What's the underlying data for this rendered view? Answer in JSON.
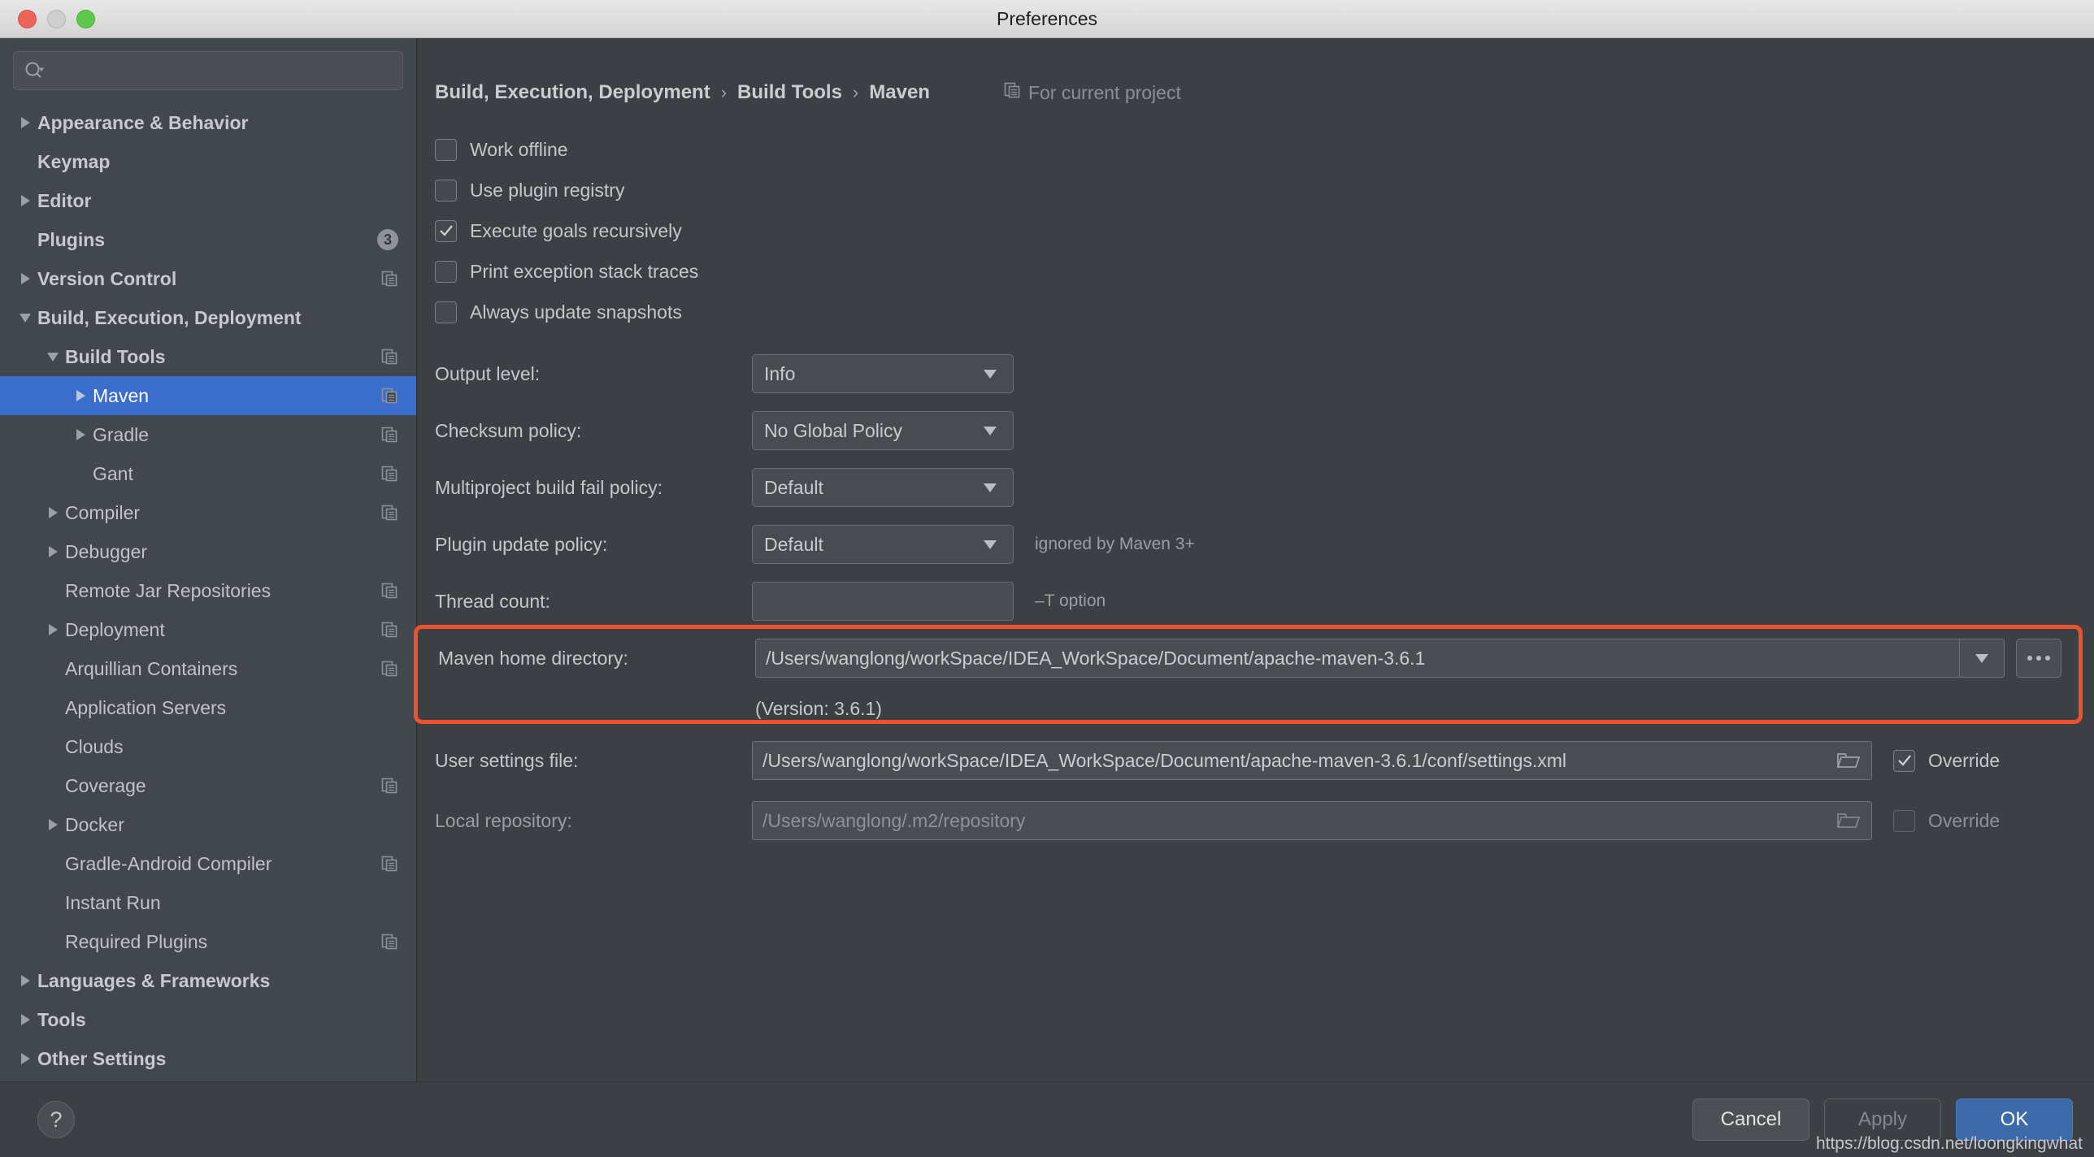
{
  "window": {
    "title": "Preferences"
  },
  "search": {
    "value": "",
    "placeholder": "",
    "icon": "search-icon"
  },
  "sidebar": {
    "items": [
      {
        "label": "Appearance & Behavior",
        "indent": 0,
        "arrow": "right",
        "bold": true,
        "scope": false,
        "badge": null,
        "selected": false
      },
      {
        "label": "Keymap",
        "indent": 0,
        "arrow": "none",
        "bold": true,
        "scope": false,
        "badge": null,
        "selected": false
      },
      {
        "label": "Editor",
        "indent": 0,
        "arrow": "right",
        "bold": true,
        "scope": false,
        "badge": null,
        "selected": false
      },
      {
        "label": "Plugins",
        "indent": 0,
        "arrow": "none",
        "bold": true,
        "scope": false,
        "badge": "3",
        "selected": false
      },
      {
        "label": "Version Control",
        "indent": 0,
        "arrow": "right",
        "bold": true,
        "scope": true,
        "badge": null,
        "selected": false
      },
      {
        "label": "Build, Execution, Deployment",
        "indent": 0,
        "arrow": "down",
        "bold": true,
        "scope": false,
        "badge": null,
        "selected": false
      },
      {
        "label": "Build Tools",
        "indent": 1,
        "arrow": "down",
        "bold": true,
        "scope": true,
        "badge": null,
        "selected": false
      },
      {
        "label": "Maven",
        "indent": 2,
        "arrow": "right",
        "bold": false,
        "scope": true,
        "badge": null,
        "selected": true
      },
      {
        "label": "Gradle",
        "indent": 2,
        "arrow": "right",
        "bold": false,
        "scope": true,
        "badge": null,
        "selected": false
      },
      {
        "label": "Gant",
        "indent": 2,
        "arrow": "none",
        "bold": false,
        "scope": true,
        "badge": null,
        "selected": false
      },
      {
        "label": "Compiler",
        "indent": 1,
        "arrow": "right",
        "bold": false,
        "scope": true,
        "badge": null,
        "selected": false
      },
      {
        "label": "Debugger",
        "indent": 1,
        "arrow": "right",
        "bold": false,
        "scope": false,
        "badge": null,
        "selected": false
      },
      {
        "label": "Remote Jar Repositories",
        "indent": 1,
        "arrow": "none",
        "bold": false,
        "scope": true,
        "badge": null,
        "selected": false
      },
      {
        "label": "Deployment",
        "indent": 1,
        "arrow": "right",
        "bold": false,
        "scope": true,
        "badge": null,
        "selected": false
      },
      {
        "label": "Arquillian Containers",
        "indent": 1,
        "arrow": "none",
        "bold": false,
        "scope": true,
        "badge": null,
        "selected": false
      },
      {
        "label": "Application Servers",
        "indent": 1,
        "arrow": "none",
        "bold": false,
        "scope": false,
        "badge": null,
        "selected": false
      },
      {
        "label": "Clouds",
        "indent": 1,
        "arrow": "none",
        "bold": false,
        "scope": false,
        "badge": null,
        "selected": false
      },
      {
        "label": "Coverage",
        "indent": 1,
        "arrow": "none",
        "bold": false,
        "scope": true,
        "badge": null,
        "selected": false
      },
      {
        "label": "Docker",
        "indent": 1,
        "arrow": "right",
        "bold": false,
        "scope": false,
        "badge": null,
        "selected": false
      },
      {
        "label": "Gradle-Android Compiler",
        "indent": 1,
        "arrow": "none",
        "bold": false,
        "scope": true,
        "badge": null,
        "selected": false
      },
      {
        "label": "Instant Run",
        "indent": 1,
        "arrow": "none",
        "bold": false,
        "scope": false,
        "badge": null,
        "selected": false
      },
      {
        "label": "Required Plugins",
        "indent": 1,
        "arrow": "none",
        "bold": false,
        "scope": true,
        "badge": null,
        "selected": false
      },
      {
        "label": "Languages & Frameworks",
        "indent": 0,
        "arrow": "right",
        "bold": true,
        "scope": false,
        "badge": null,
        "selected": false
      },
      {
        "label": "Tools",
        "indent": 0,
        "arrow": "right",
        "bold": true,
        "scope": false,
        "badge": null,
        "selected": false
      },
      {
        "label": "Other Settings",
        "indent": 0,
        "arrow": "right",
        "bold": true,
        "scope": false,
        "badge": null,
        "selected": false
      }
    ]
  },
  "main": {
    "breadcrumb": [
      "Build, Execution, Deployment",
      "Build Tools",
      "Maven"
    ],
    "breadcrumb_separator": "›",
    "for_current_project": "For current project",
    "checkboxes": [
      {
        "label": "Work offline",
        "checked": false
      },
      {
        "label": "Use plugin registry",
        "checked": false
      },
      {
        "label": "Execute goals recursively",
        "checked": true
      },
      {
        "label": "Print exception stack traces",
        "checked": false
      },
      {
        "label": "Always update snapshots",
        "checked": false
      }
    ],
    "combos": [
      {
        "label": "Output level:",
        "value": "Info",
        "note": ""
      },
      {
        "label": "Checksum policy:",
        "value": "No Global Policy",
        "note": ""
      },
      {
        "label": "Multiproject build fail policy:",
        "value": "Default",
        "note": ""
      },
      {
        "label": "Plugin update policy:",
        "value": "Default",
        "note": "ignored by Maven 3+"
      }
    ],
    "thread_count": {
      "label": "Thread count:",
      "value": "",
      "note": "–T option"
    },
    "maven_home": {
      "label": "Maven home directory:",
      "value": "/Users/wanglong/workSpace/IDEA_WorkSpace/Document/apache-maven-3.6.1",
      "version_note": "(Version: 3.6.1)",
      "browse_label": "...",
      "highlight_color": "#f0512a"
    },
    "user_settings": {
      "label": "User settings file:",
      "value": "/Users/wanglong/workSpace/IDEA_WorkSpace/Document/apache-maven-3.6.1/conf/settings.xml",
      "override_label": "Override",
      "override_checked": true,
      "disabled": false
    },
    "local_repository": {
      "label": "Local repository:",
      "value": "/Users/wanglong/.m2/repository",
      "override_label": "Override",
      "override_checked": false,
      "disabled": true
    }
  },
  "footer": {
    "help_label": "?",
    "cancel_label": "Cancel",
    "apply_label": "Apply",
    "ok_label": "OK",
    "watermark": "https://blog.csdn.net/loongkingwhat"
  }
}
